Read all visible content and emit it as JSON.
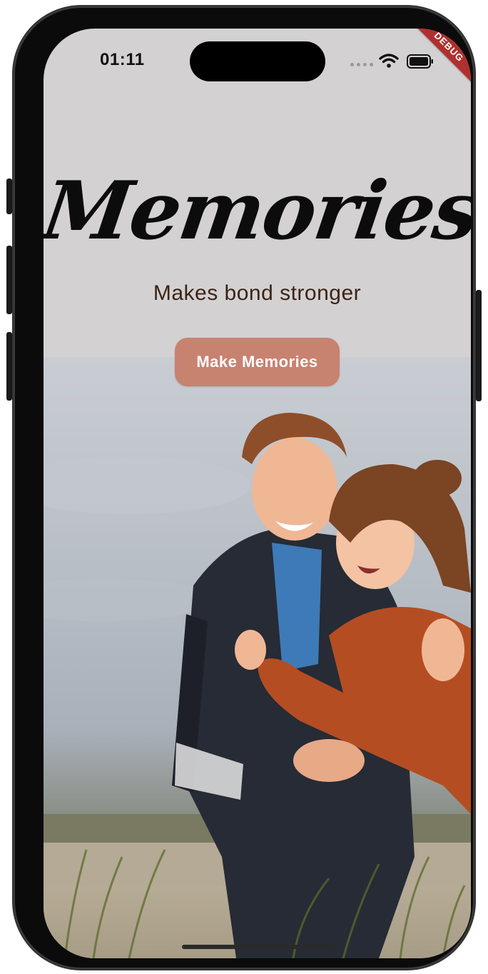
{
  "status_bar": {
    "time": "01:11",
    "wifi_icon": "wifi-icon",
    "battery_icon": "battery-icon",
    "signal_icon": "signal-dots-icon"
  },
  "debug_banner": {
    "label": "DEBUG",
    "color": "#b0302e"
  },
  "hero": {
    "title": "Memories",
    "subtitle": "Makes bond stronger",
    "button_label": "Make Memories",
    "button_color": "#c88270",
    "background_color": "#d4d1d2"
  },
  "photo": {
    "description_icon": "couple-photo"
  }
}
